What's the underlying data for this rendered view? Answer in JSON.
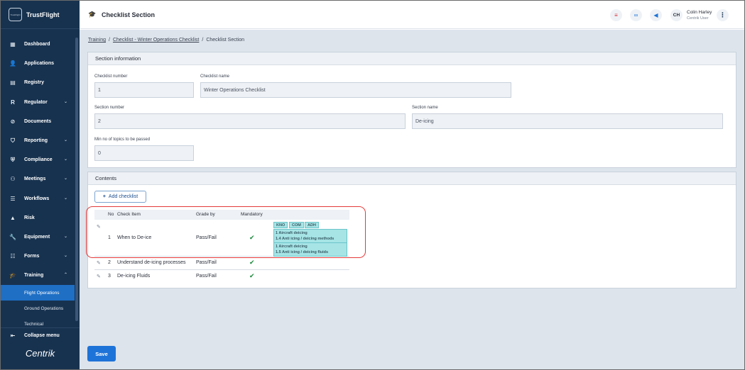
{
  "brand": {
    "logo_text": "TrustFlight",
    "name": "TrustFlight"
  },
  "nav": {
    "items": [
      {
        "label": "Dashboard",
        "icon": "dashboard-icon",
        "chevron": false
      },
      {
        "label": "Applications",
        "icon": "user-icon",
        "chevron": false
      },
      {
        "label": "Registry",
        "icon": "book-icon",
        "chevron": false
      },
      {
        "label": "Regulator",
        "icon": "letter-r-icon",
        "chevron": true
      },
      {
        "label": "Documents",
        "icon": "paperclip-icon",
        "chevron": false
      },
      {
        "label": "Reporting",
        "icon": "shield-icon",
        "chevron": true
      },
      {
        "label": "Compliance",
        "icon": "shield-check-icon",
        "chevron": true
      },
      {
        "label": "Meetings",
        "icon": "meetings-icon",
        "chevron": true
      },
      {
        "label": "Workflows",
        "icon": "layers-icon",
        "chevron": true
      },
      {
        "label": "Risk",
        "icon": "warning-icon",
        "chevron": false
      },
      {
        "label": "Equipment",
        "icon": "wrench-icon",
        "chevron": true
      },
      {
        "label": "Forms",
        "icon": "forms-icon",
        "chevron": true
      },
      {
        "label": "Training",
        "icon": "graduation-cap-icon",
        "chevron": true
      }
    ],
    "sub_items": [
      "Flight Operations",
      "Ground Operations",
      "Technical"
    ],
    "collapse_label": "Collapse menu",
    "footer_logo": "Centrik"
  },
  "header": {
    "title": "Checklist Section",
    "user_initials": "CH",
    "user_name": "Colin Harley",
    "user_role": "Centrik User"
  },
  "breadcrumb": [
    "Training",
    "Checklist - Winter Operations Checklist",
    "Checklist Section"
  ],
  "section_info": {
    "heading": "Section information",
    "checklist_number_label": "Checklist number",
    "checklist_number": "1",
    "checklist_name_label": "Checklist name",
    "checklist_name": "Winter Operations Checklist",
    "section_number_label": "Section number",
    "section_number": "2",
    "section_name_label": "Section name",
    "section_name": "De-icing",
    "min_topics_label": "Min no of topics to be passed",
    "min_topics": "0"
  },
  "contents": {
    "heading": "Contents",
    "add_button": "Add checklist",
    "columns": {
      "no": "No",
      "item": "Check Item",
      "grade": "Grade by",
      "mandatory": "Mandatory"
    },
    "rows": [
      {
        "no": "1",
        "item": "When to De-ice",
        "grade": "Pass/Fail",
        "mandatory": "✔"
      },
      {
        "no": "2",
        "item": "Understand de-icing processes",
        "grade": "Pass/Fail",
        "mandatory": "✔"
      },
      {
        "no": "3",
        "item": "De-icing Fluids",
        "grade": "Pass/Fail",
        "mandatory": "✔"
      }
    ],
    "tags": [
      "KNO",
      "COM",
      "ADH"
    ],
    "tag_groups": [
      [
        "1 Aircraft deicing",
        "1.4 Anti icing / deicing methods"
      ],
      [
        "1 Aircraft deicing",
        "1.5 Anti icing / deicing fluids"
      ]
    ]
  },
  "footer": {
    "save": "Save"
  }
}
